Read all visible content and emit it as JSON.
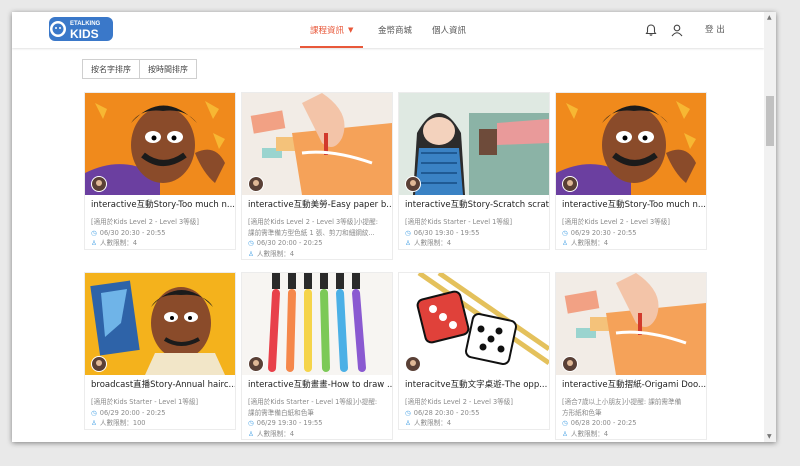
{
  "header": {
    "logo_top": "ETALKING",
    "logo_main": "KIDS",
    "nav": [
      {
        "label": "課程資訊",
        "active": true
      },
      {
        "label": "金幣商城",
        "active": false
      },
      {
        "label": "個人資訊",
        "active": false
      }
    ],
    "logout": "登 出",
    "icons": [
      "bell-icon",
      "user-icon"
    ]
  },
  "sort": {
    "by_name": "按名字排序",
    "by_time": "按時間排序"
  },
  "cards": [
    {
      "title": "interactive互動Story-Too much n...",
      "meta": [
        "[適用於Kids Level 2 - Level 3等級]"
      ],
      "time": "06/30 20:30 - 20:55",
      "count": "人數限制：4",
      "image": "cartoon-man"
    },
    {
      "title": "interactive互動美勞-Easy paper b...",
      "meta": [
        "[適用於Kids Level 2 - Level 3等級]小提醒:",
        "課前需準備方型色紙 1 張、剪刀和細鋼紋..."
      ],
      "time": "06/30 20:00 - 20:25",
      "count": "人數限制：4",
      "image": "paper-craft"
    },
    {
      "title": "interactive互動Story-Scratch scrat...",
      "meta": [
        "[適用於Kids Starter - Level 1等級]"
      ],
      "time": "06/30 19:30 - 19:55",
      "count": "人數限制：4",
      "image": "girl-scratch"
    },
    {
      "title": "interactive互動Story-Too much n...",
      "meta": [
        "[適用於Kids Level 2 - Level 3等級]"
      ],
      "time": "06/29 20:30 - 20:55",
      "count": "人數限制：4",
      "image": "cartoon-man"
    },
    {
      "title": "broadcast直播Story-Annual hairc...",
      "meta": [
        "[適用於Kids Starter - Level 1等級]"
      ],
      "time": "06/29 20:00 - 20:25",
      "count": "人數限制：100",
      "image": "haircut"
    },
    {
      "title": "interactive互動畫畫-How to draw ...",
      "meta": [
        "[適用於Kids Starter - Level 1等級]小提醒:",
        "課前需準備白紙和色筆"
      ],
      "time": "06/29 19:30 - 19:55",
      "count": "人數限制：4",
      "image": "markers"
    },
    {
      "title": "interacitve互動文字桌遊-The opp...",
      "meta": [
        "[適用於Kids Level 2 - Level 3等級]"
      ],
      "time": "06/28 20:30 - 20:55",
      "count": "人數限制：4",
      "image": "dice"
    },
    {
      "title": "interactive互動摺紙-Origami Doo...",
      "meta": [
        "[適合7歲以上小朋友]小提醒: 課前需準備",
        "方形紙和色筆"
      ],
      "time": "06/28 20:00 - 20:25",
      "count": "人數限制：4",
      "image": "paper-craft"
    }
  ],
  "colors": {
    "accent": "#e8583a",
    "logo_blue": "#3a78c9",
    "meta_icon": "#4aa3e6"
  }
}
